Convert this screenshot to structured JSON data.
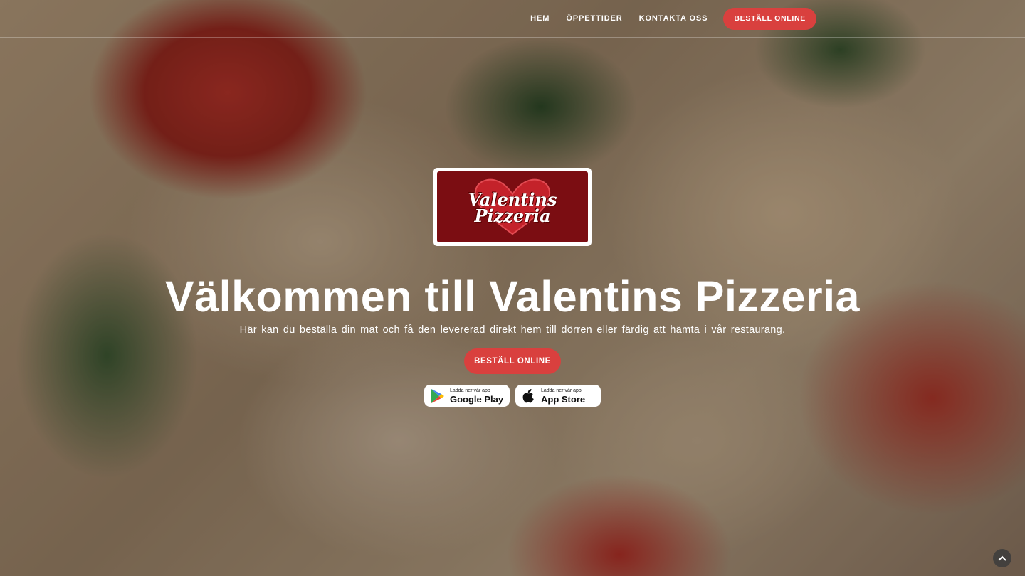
{
  "nav": {
    "links": [
      "HEM",
      "ÖPPETTIDER",
      "KONTAKTA OSS"
    ],
    "cta_label": "BESTÄLL ONLINE"
  },
  "logo": {
    "line1": "Valentins",
    "line2": "Pizzeria"
  },
  "hero": {
    "title": "Välkommen till Valentins Pizzeria",
    "subtitle": "Här kan du beställa din mat och få den levererad direkt hem till dörren eller färdig att hämta i vår restaurang.",
    "cta_label": "BESTÄLL ONLINE"
  },
  "stores": {
    "google_small": "Ladda ner vår app",
    "google_big": "Google Play",
    "apple_small": "Ladda ner vår app",
    "apple_big": "App Store"
  },
  "colors": {
    "accent": "#d9403e",
    "logo_bg": "#7b0d12"
  },
  "icons": {
    "google": "google-play-icon",
    "apple": "apple-icon",
    "scroll": "chevron-up-icon"
  }
}
